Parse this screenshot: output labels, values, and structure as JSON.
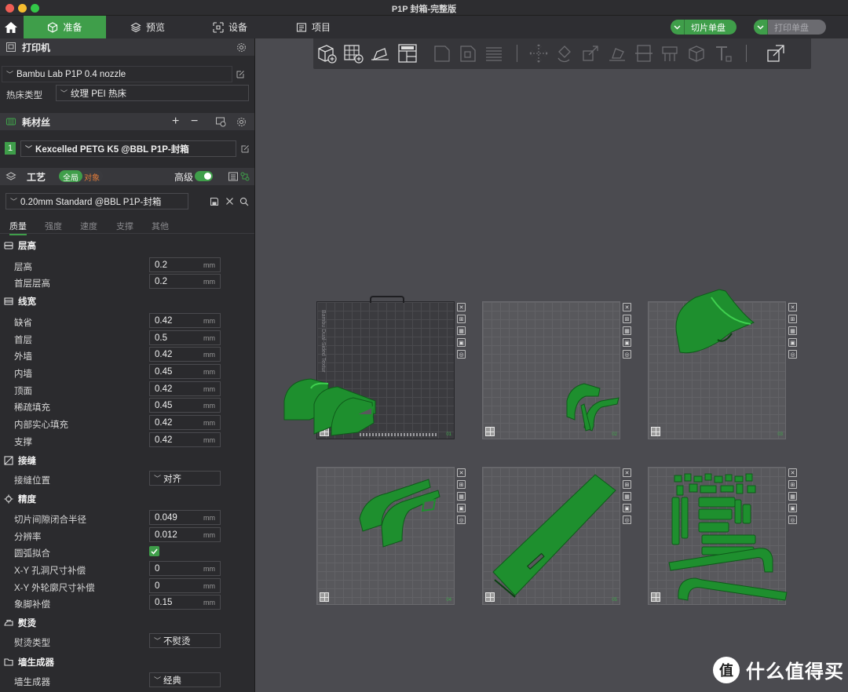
{
  "window": {
    "title": "P1P 封箱-完整版"
  },
  "topnav": {
    "tabs": [
      {
        "label": "准备",
        "icon": "cube-icon",
        "active": true
      },
      {
        "label": "预览",
        "icon": "layers-icon",
        "active": false
      },
      {
        "label": "设备",
        "icon": "device-icon",
        "active": false
      },
      {
        "label": "项目",
        "icon": "project-icon",
        "active": false
      }
    ],
    "slice_button": "切片单盘",
    "print_button": "打印单盘",
    "accent": "#3f9e4a"
  },
  "printer": {
    "section_title": "打印机",
    "profile": "Bambu Lab P1P 0.4 nozzle",
    "bed_type_label": "热床类型",
    "bed_type_value": "纹理 PEI 热床"
  },
  "filament": {
    "section_title": "耗材丝",
    "slot_number": "1",
    "profile": "Kexcelled PETG K5 @BBL P1P-封箱"
  },
  "process": {
    "section_title": "工艺",
    "toggle_global": "全局",
    "toggle_object": "对象",
    "advanced_label": "高级",
    "profile": "0.20mm Standard @BBL P1P-封箱",
    "tabs": [
      "质量",
      "强度",
      "速度",
      "支撑",
      "其他"
    ],
    "unit": "mm",
    "groups": {
      "layer_height": {
        "title": "层高",
        "rows": [
          {
            "label": "层高",
            "value": "0.2"
          },
          {
            "label": "首层层高",
            "value": "0.2"
          }
        ]
      },
      "line_width": {
        "title": "线宽",
        "rows": [
          {
            "label": "缺省",
            "value": "0.42"
          },
          {
            "label": "首层",
            "value": "0.5"
          },
          {
            "label": "外墙",
            "value": "0.42"
          },
          {
            "label": "内墙",
            "value": "0.45"
          },
          {
            "label": "顶面",
            "value": "0.42"
          },
          {
            "label": "稀疏填充",
            "value": "0.45"
          },
          {
            "label": "内部实心填充",
            "value": "0.42"
          },
          {
            "label": "支撑",
            "value": "0.42"
          }
        ]
      },
      "seam": {
        "title": "接缝",
        "label": "接缝位置",
        "value": "对齐"
      },
      "precision": {
        "title": "精度",
        "rows": [
          {
            "label": "切片间隙闭合半径",
            "value": "0.049"
          },
          {
            "label": "分辨率",
            "value": "0.012"
          }
        ],
        "arc_label": "圆弧拟合",
        "arc_checked": true,
        "rows2": [
          {
            "label": "X-Y 孔洞尺寸补偿",
            "value": "0"
          },
          {
            "label": "X-Y 外轮廓尺寸补偿",
            "value": "0"
          },
          {
            "label": "象脚补偿",
            "value": "0.15"
          }
        ]
      },
      "ironing": {
        "title": "熨烫",
        "label": "熨烫类型",
        "value": "不熨烫"
      },
      "wall_generator": {
        "title": "墙生成器",
        "label": "墙生成器",
        "value": "经典"
      }
    }
  },
  "plates": [
    {
      "number": "01",
      "selected": true,
      "bed_text": "Bambu Dual-Sided Textur"
    },
    {
      "number": "02",
      "selected": false
    },
    {
      "number": "03",
      "selected": false
    },
    {
      "number": "04",
      "selected": false
    },
    {
      "number": "05",
      "selected": false
    },
    {
      "number": "06",
      "selected": false
    }
  ],
  "watermark": {
    "text": "什么值得买",
    "logo_char": "值"
  },
  "colors": {
    "part_green": "#1e8f2e",
    "part_dark": "#0f5a1a"
  }
}
